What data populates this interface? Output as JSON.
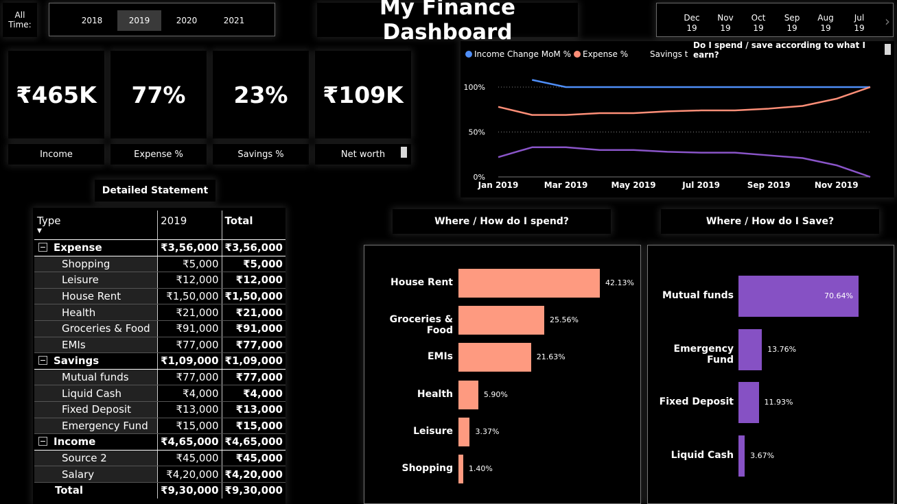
{
  "top": {
    "all_time_label": "All\nTime:",
    "years": [
      "2018",
      "2019",
      "2020",
      "2021"
    ],
    "selected_year": "2019",
    "title": "My Finance Dashboard",
    "months": [
      {
        "mon": "Dec",
        "yr": "19"
      },
      {
        "mon": "Nov",
        "yr": "19"
      },
      {
        "mon": "Oct",
        "yr": "19"
      },
      {
        "mon": "Sep",
        "yr": "19"
      },
      {
        "mon": "Aug",
        "yr": "19"
      },
      {
        "mon": "Jul",
        "yr": "19"
      }
    ],
    "next_icon": "chevron-right-icon"
  },
  "kpis": [
    {
      "value": "₹465K",
      "label": "Income"
    },
    {
      "value": "77%",
      "label": "Expense %"
    },
    {
      "value": "23%",
      "label": "Savings %"
    },
    {
      "value": "₹109K",
      "label": "Net worth"
    }
  ],
  "trend": {
    "tooltip": "Do I spend / save according to what I earn?",
    "legend": [
      {
        "name": "Income Change MoM %",
        "color": "#4f8ef7"
      },
      {
        "name": "Expense %",
        "color": "#fe8f78"
      },
      {
        "name": "Savings target",
        "color": ""
      },
      {
        "name": "",
        "color": "#8a55c9"
      }
    ]
  },
  "chart_data": {
    "type": "line",
    "x": [
      "Jan 2019",
      "Feb 2019",
      "Mar 2019",
      "Apr 2019",
      "May 2019",
      "Jun 2019",
      "Jul 2019",
      "Aug 2019",
      "Sep 2019",
      "Oct 2019",
      "Nov 2019",
      "Dec 2019"
    ],
    "x_tick_labels": [
      "Jan 2019",
      "Mar 2019",
      "May 2019",
      "Jul 2019",
      "Sep 2019",
      "Nov 2019"
    ],
    "y_tick_labels": [
      "0%",
      "50%",
      "100%"
    ],
    "ylim": [
      0,
      100
    ],
    "grid": true,
    "legend_position": "top",
    "series": [
      {
        "name": "Income Change MoM %",
        "color": "#4f8ef7",
        "values": [
          null,
          108,
          100,
          100,
          100,
          100,
          100,
          100,
          100,
          100,
          100,
          100
        ]
      },
      {
        "name": "Expense %",
        "color": "#fe8f78",
        "values": [
          78,
          69,
          69,
          71,
          71,
          73,
          74,
          74,
          76,
          79,
          87,
          100
        ]
      },
      {
        "name": "",
        "color": "#8a55c9",
        "values": [
          22,
          33,
          33,
          30,
          30,
          28,
          27,
          27,
          24,
          21,
          13,
          0
        ]
      }
    ]
  },
  "statement": {
    "title": "Detailed Statement",
    "headers": [
      "Type",
      "2019",
      "Total"
    ],
    "rows": [
      {
        "kind": "grp",
        "name": "Expense",
        "y2019": "₹3,56,000",
        "total": "₹3,56,000"
      },
      {
        "kind": "sub",
        "name": "Shopping",
        "y2019": "₹5,000",
        "total": "₹5,000"
      },
      {
        "kind": "sub",
        "name": "Leisure",
        "y2019": "₹12,000",
        "total": "₹12,000"
      },
      {
        "kind": "sub",
        "name": "House Rent",
        "y2019": "₹1,50,000",
        "total": "₹1,50,000"
      },
      {
        "kind": "sub",
        "name": "Health",
        "y2019": "₹21,000",
        "total": "₹21,000"
      },
      {
        "kind": "sub",
        "name": "Groceries & Food",
        "y2019": "₹91,000",
        "total": "₹91,000"
      },
      {
        "kind": "sub",
        "name": "EMIs",
        "y2019": "₹77,000",
        "total": "₹77,000"
      },
      {
        "kind": "grp",
        "name": "Savings",
        "y2019": "₹1,09,000",
        "total": "₹1,09,000"
      },
      {
        "kind": "sub",
        "name": "Mutual funds",
        "y2019": "₹77,000",
        "total": "₹77,000"
      },
      {
        "kind": "sub",
        "name": "Liquid Cash",
        "y2019": "₹4,000",
        "total": "₹4,000"
      },
      {
        "kind": "sub",
        "name": "Fixed Deposit",
        "y2019": "₹13,000",
        "total": "₹13,000"
      },
      {
        "kind": "sub",
        "name": "Emergency Fund",
        "y2019": "₹15,000",
        "total": "₹15,000"
      },
      {
        "kind": "grp",
        "name": "Income",
        "y2019": "₹4,65,000",
        "total": "₹4,65,000"
      },
      {
        "kind": "sub",
        "name": "Source 2",
        "y2019": "₹45,000",
        "total": "₹45,000"
      },
      {
        "kind": "sub",
        "name": "Salary",
        "y2019": "₹4,20,000",
        "total": "₹4,20,000"
      },
      {
        "kind": "tot",
        "name": "Total",
        "y2019": "₹9,30,000",
        "total": "₹9,30,000"
      }
    ]
  },
  "spend": {
    "title": "Where / How do I spend?",
    "color": "#fe9a80",
    "items": [
      {
        "label": "House Rent",
        "pct": 42.13,
        "text": "42.13%"
      },
      {
        "label": "Groceries & Food",
        "pct": 25.56,
        "text": "25.56%"
      },
      {
        "label": "EMIs",
        "pct": 21.63,
        "text": "21.63%"
      },
      {
        "label": "Health",
        "pct": 5.9,
        "text": "5.90%"
      },
      {
        "label": "Leisure",
        "pct": 3.37,
        "text": "3.37%"
      },
      {
        "label": "Shopping",
        "pct": 1.4,
        "text": "1.40%"
      }
    ]
  },
  "save": {
    "title": "Where / How do I Save?",
    "color": "#8651c4",
    "items": [
      {
        "label": "Mutual funds",
        "pct": 70.64,
        "text": "70.64%"
      },
      {
        "label": "Emergency Fund",
        "pct": 13.76,
        "text": "13.76%"
      },
      {
        "label": "Fixed Deposit",
        "pct": 11.93,
        "text": "11.93%"
      },
      {
        "label": "Liquid Cash",
        "pct": 3.67,
        "text": "3.67%"
      }
    ]
  }
}
